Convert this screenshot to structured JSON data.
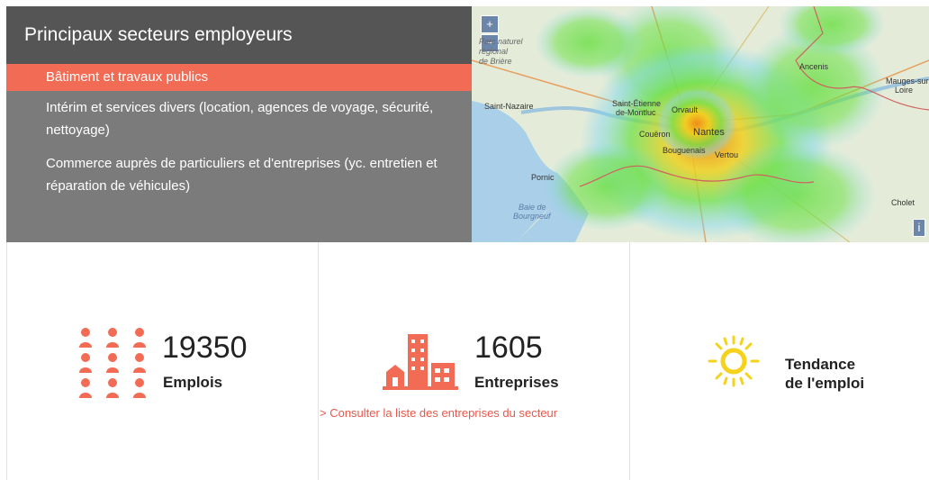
{
  "sectors": {
    "title": "Principaux secteurs employeurs",
    "items": [
      {
        "label": "Bâtiment et travaux publics",
        "active": true
      },
      {
        "label": "Intérim et services divers (location, agences de voyage, sécurité, nettoyage)",
        "active": false
      },
      {
        "label": "Commerce auprès de particuliers et d'entreprises (yc. entretien et réparation de véhicules)",
        "active": false
      }
    ]
  },
  "map": {
    "zoom_in": "+",
    "zoom_out": "−",
    "info": "i",
    "labels": {
      "parc_line1": "Parc naturel",
      "parc_line2": "régional",
      "parc_line3": "de Brière",
      "saint_nazaire": "Saint-Nazaire",
      "saint_etienne_1": "Saint-Étienne",
      "saint_etienne_2": "de-Montluc",
      "orvault": "Orvault",
      "couëron": "Couëron",
      "nantes": "Nantes",
      "bouguenais": "Bouguenais",
      "vertou": "Vertou",
      "ancenis": "Ancenis",
      "mauges_1": "Mauges-sur-",
      "mauges_2": "Loire",
      "pornic": "Pornic",
      "baie_1": "Baie de",
      "baie_2": "Bourgneuf",
      "cholet": "Cholet"
    },
    "colors": {
      "heat_low": "#7fd7f0",
      "heat_mid": "#6fe04a",
      "heat_high": "#f0d020",
      "heat_peak": "#f08a1a"
    }
  },
  "stats": {
    "jobs": {
      "value": "19350",
      "label": "Emplois",
      "icon": "people-grid-icon"
    },
    "companies": {
      "value": "1605",
      "label": "Entreprises",
      "icon": "buildings-icon",
      "link": "> Consulter la liste des entreprises du secteur"
    },
    "trend": {
      "label_line1": "Tendance",
      "label_line2": "de l'emploi",
      "icon": "sun-icon"
    }
  },
  "colors": {
    "accent": "#f26c55",
    "header_dark": "#555555",
    "panel_grey": "#7b7b7b",
    "link": "#e8574a",
    "sun": "#f5d21c"
  }
}
